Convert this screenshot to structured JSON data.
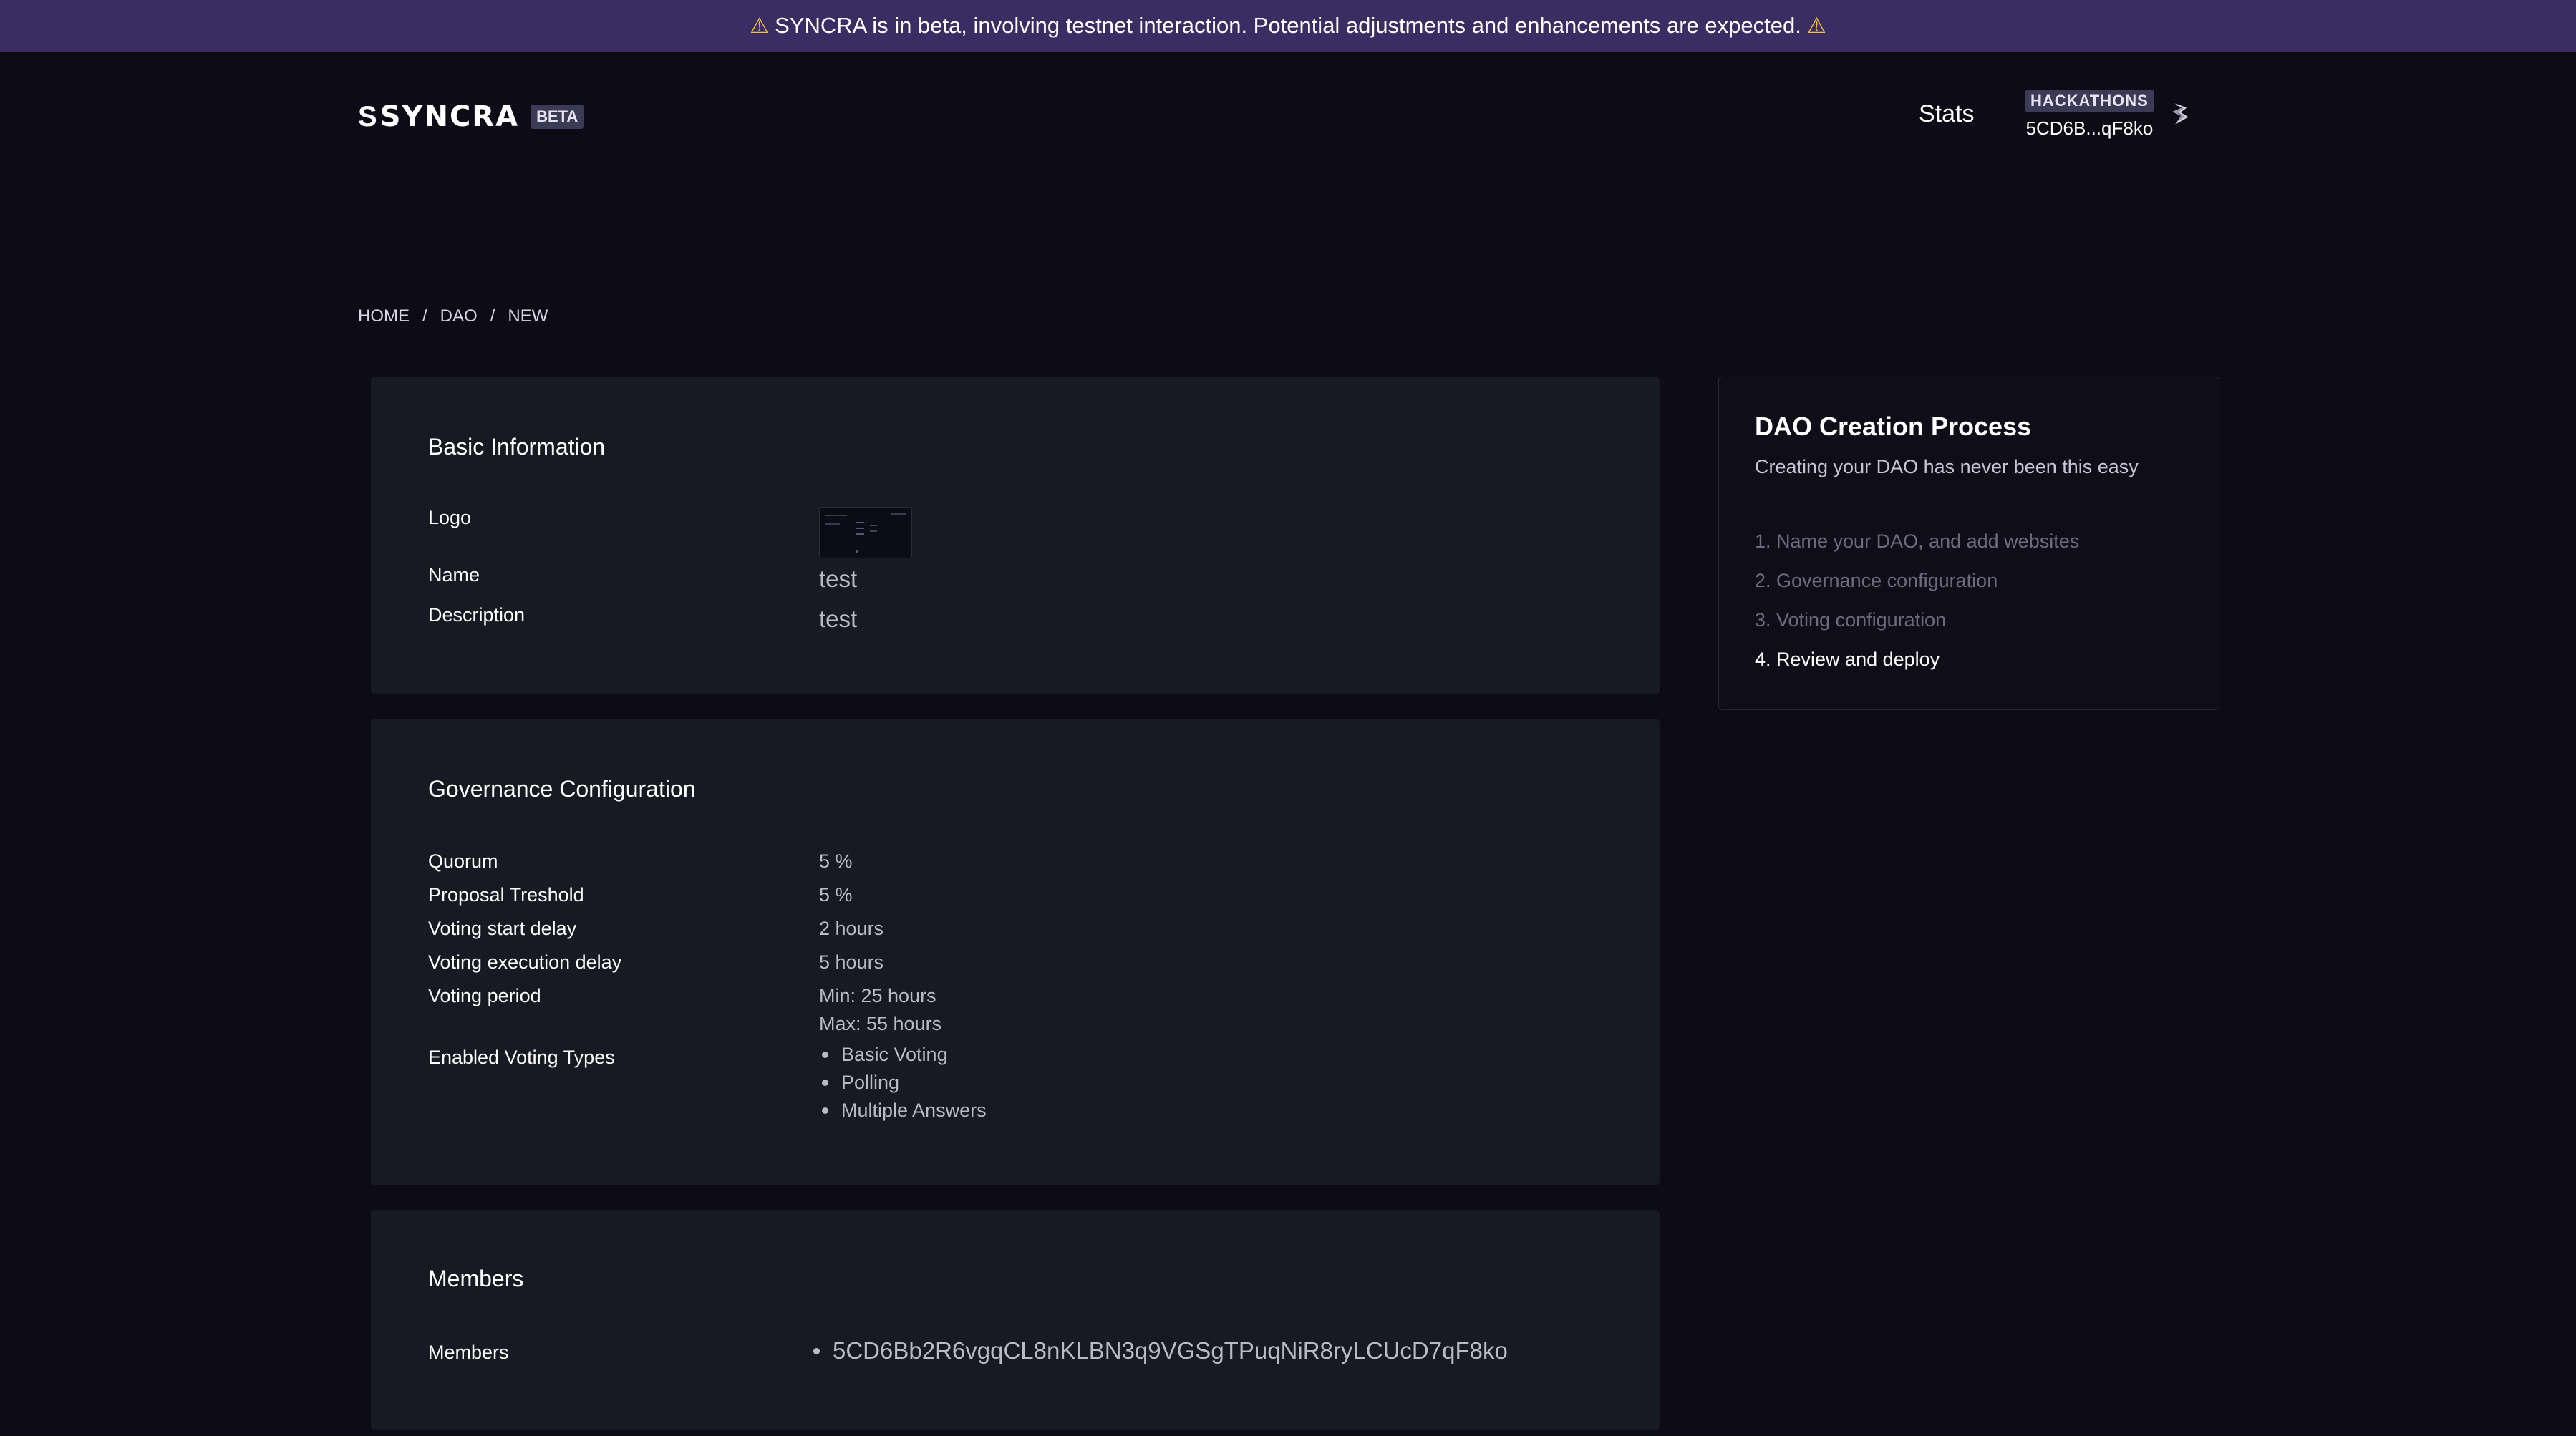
{
  "banner": {
    "icon_left": "warning-icon",
    "text": "SYNCRA is in beta, involving testnet interaction. Potential adjustments and enhancements are expected.",
    "icon_right": "warning-icon",
    "icon_glyph": "⚠"
  },
  "header": {
    "logo_mark": "S",
    "logo_text": "SYNCRA",
    "beta_badge": "BETA",
    "nav": {
      "stats": "Stats"
    },
    "account": {
      "badge": "HACKATHONS",
      "address_short": "5CD6B...qF8ko"
    }
  },
  "breadcrumb": [
    "HOME",
    "/",
    "DAO",
    "/",
    "NEW"
  ],
  "basic_info": {
    "title": "Basic Information",
    "logo_label": "Logo",
    "name_label": "Name",
    "name_value": "test",
    "description_label": "Description",
    "description_value": "test"
  },
  "governance": {
    "title": "Governance Configuration",
    "quorum_label": "Quorum",
    "quorum_value": "5 %",
    "proposal_label": "Proposal Treshold",
    "proposal_value": "5 %",
    "start_delay_label": "Voting start delay",
    "start_delay_value": "2 hours",
    "exec_delay_label": "Voting execution delay",
    "exec_delay_value": "5 hours",
    "period_label": "Voting period",
    "period_min": "Min: 25 hours",
    "period_max": "Max: 55 hours",
    "types_label": "Enabled Voting Types",
    "types": [
      "Basic Voting",
      "Polling",
      "Multiple Answers"
    ]
  },
  "members": {
    "title": "Members",
    "label": "Members",
    "list": [
      "5CD6Bb2R6vgqCL8nKLBN3q9VGSgTPuqNiR8ryLCUcD7qF8ko"
    ]
  },
  "process": {
    "title": "DAO Creation Process",
    "subtitle": "Creating your DAO has never been this easy",
    "steps": [
      "1. Name your DAO, and add websites",
      "2. Governance configuration",
      "3. Voting configuration",
      "4. Review and deploy"
    ],
    "active_step": 4
  },
  "colors": {
    "background": "#0d0b16",
    "banner": "#3a2d63",
    "card": "#171923",
    "muted_text": "#b9bac6"
  }
}
